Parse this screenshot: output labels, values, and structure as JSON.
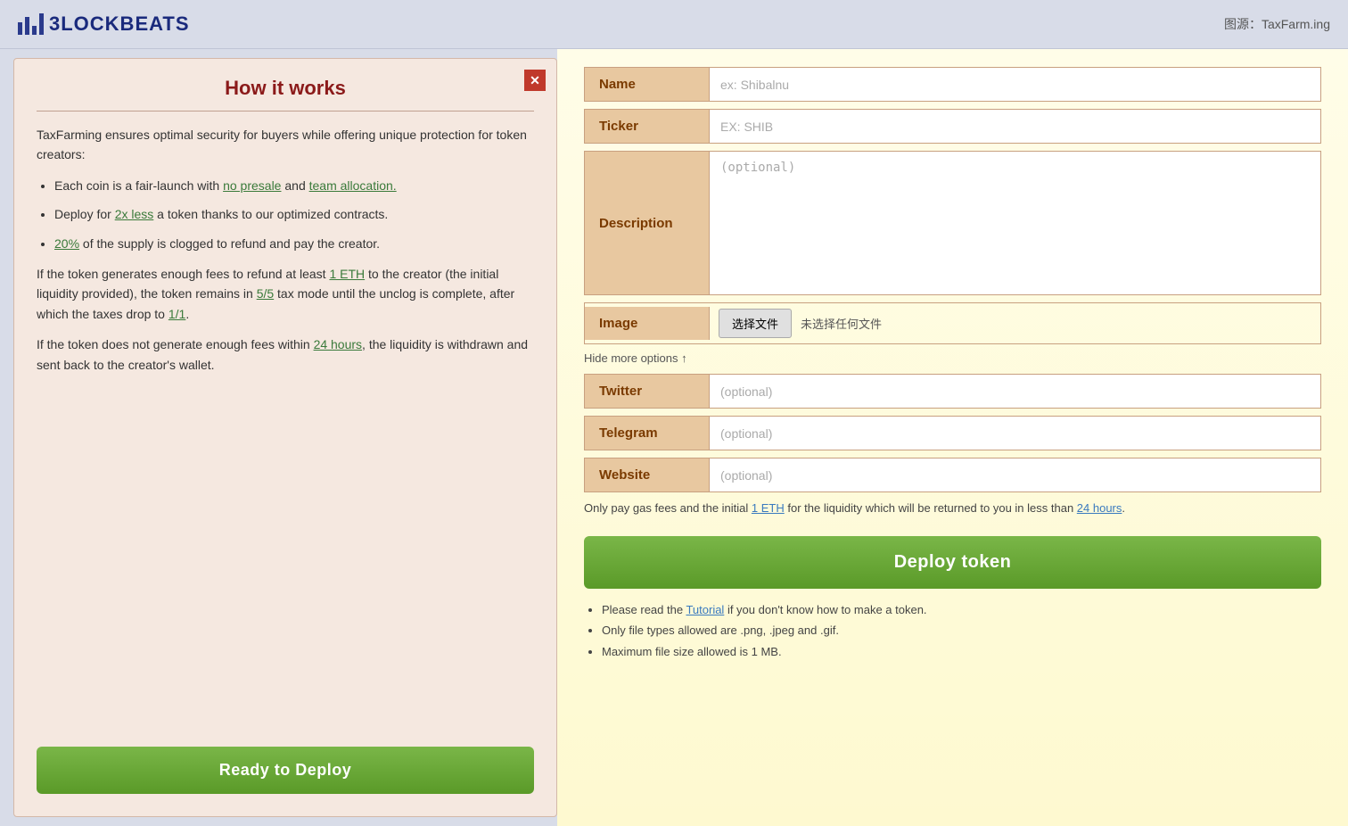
{
  "header": {
    "logo_text": "3LOCKBEATS",
    "source_label": "图源：TaxFarm.ing"
  },
  "left_panel": {
    "title": "How it works",
    "close_button_label": "✕",
    "intro": "TaxFarming ensures optimal security for buyers while offering unique protection for token creators:",
    "bullets": [
      {
        "text_before": "Each coin is a fair-launch with ",
        "link1_text": "no presale",
        "text_middle": " and ",
        "link2_text": "team allocation.",
        "text_after": ""
      },
      {
        "text_before": "Deploy for ",
        "link1_text": "2x less",
        "text_after": " a token thanks to our optimized contracts."
      },
      {
        "text_before": "",
        "link1_text": "20%",
        "text_after": " of the supply is clogged to refund and pay the creator."
      }
    ],
    "paragraph2_before": "If the token generates enough fees to refund at least ",
    "paragraph2_link": "1 ETH",
    "paragraph2_after": " to the creator (the initial liquidity provided), the token remains in ",
    "paragraph2_link2": "5/5",
    "paragraph2_middle": " tax mode until the unclog is complete, after which the taxes drop to ",
    "paragraph2_link3": "1/1",
    "paragraph2_end": ".",
    "paragraph3_before": "If the token does not generate enough fees within ",
    "paragraph3_link": "24 hours",
    "paragraph3_after": ", the liquidity is withdrawn and sent back to the creator's wallet.",
    "ready_button": "Ready to Deploy"
  },
  "right_panel": {
    "form": {
      "name_label": "Name",
      "name_placeholder": "ex: Shibalnu",
      "ticker_label": "Ticker",
      "ticker_placeholder": "EX: SHIB",
      "description_label": "Description",
      "description_placeholder": "(optional)",
      "image_label": "Image",
      "file_button_label": "选择文件",
      "no_file_label": "未选择任何文件",
      "toggle_label": "Hide more options ↑",
      "twitter_label": "Twitter",
      "twitter_placeholder": "(optional)",
      "telegram_label": "Telegram",
      "telegram_placeholder": "(optional)",
      "website_label": "Website",
      "website_placeholder": "(optional)"
    },
    "liquidity_note_before": "Only pay gas fees and the initial ",
    "liquidity_note_link": "1 ETH",
    "liquidity_note_after": " for the liquidity which will be returned to you in less than ",
    "liquidity_note_link2": "24 hours",
    "liquidity_note_end": ".",
    "deploy_button": "Deploy token",
    "footer_notes": [
      "Please read the Tutorial if you don't know how to make a token.",
      "Only file types allowed are .png, .jpeg and .gif.",
      "Maximum file size allowed is 1 MB."
    ],
    "tutorial_link_text": "Tutorial"
  }
}
